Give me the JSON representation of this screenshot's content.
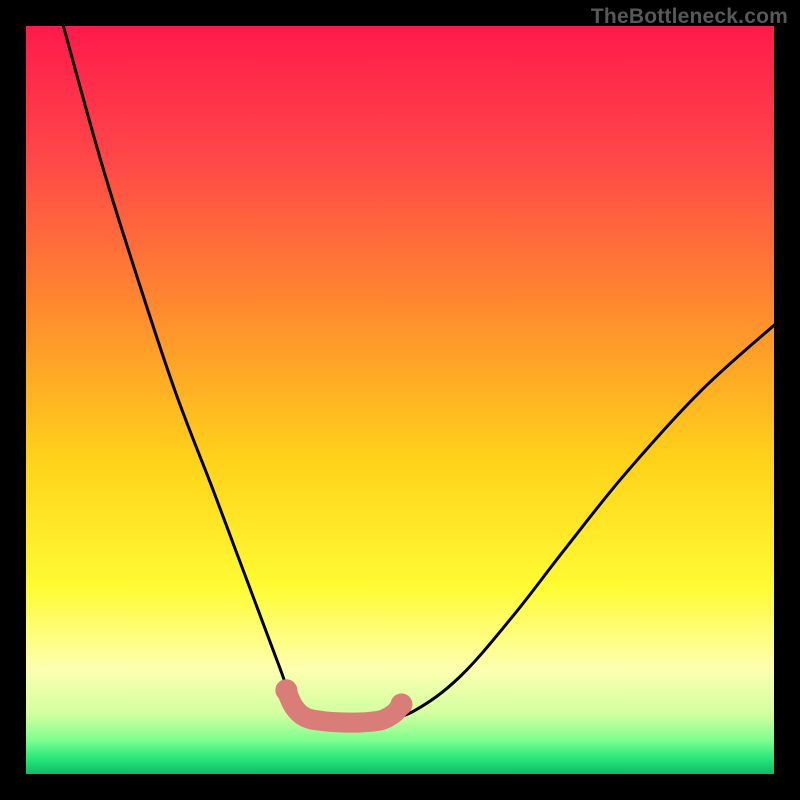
{
  "watermark": "TheBottleneck.com",
  "chart_data": {
    "type": "line",
    "title": "",
    "xlabel": "",
    "ylabel": "",
    "xlim": [
      0,
      100
    ],
    "ylim": [
      0,
      100
    ],
    "series": [
      {
        "name": "curve",
        "x": [
          5,
          10,
          15,
          20,
          25,
          28,
          31,
          34,
          35.5,
          37,
          39,
          42,
          45,
          48,
          52,
          58,
          65,
          72,
          80,
          90,
          100
        ],
        "y": [
          100,
          82,
          66,
          51,
          38,
          30,
          22,
          14,
          10,
          8,
          7.2,
          7.0,
          7.0,
          7.3,
          8.5,
          13,
          21,
          30,
          40,
          51,
          60
        ]
      }
    ],
    "highlight_segment": {
      "name": "bottom-plateau",
      "color": "#d97d79",
      "x": [
        34.8,
        35.8,
        37.3,
        39.5,
        42,
        45,
        47.5,
        49.2,
        50.2
      ],
      "y": [
        11.2,
        9.0,
        7.6,
        7.1,
        6.9,
        6.9,
        7.2,
        8.1,
        9.3
      ]
    },
    "gradient_stops": [
      {
        "offset": 0.0,
        "color": "#ff1a4b"
      },
      {
        "offset": 0.18,
        "color": "#ff4848"
      },
      {
        "offset": 0.38,
        "color": "#ff8b2e"
      },
      {
        "offset": 0.58,
        "color": "#ffd21a"
      },
      {
        "offset": 0.75,
        "color": "#fffb33"
      },
      {
        "offset": 0.86,
        "color": "#fdffb0"
      },
      {
        "offset": 0.92,
        "color": "#d2ffa0"
      },
      {
        "offset": 0.955,
        "color": "#7dff8f"
      },
      {
        "offset": 0.98,
        "color": "#25e67a"
      },
      {
        "offset": 1.0,
        "color": "#13b866"
      }
    ]
  }
}
